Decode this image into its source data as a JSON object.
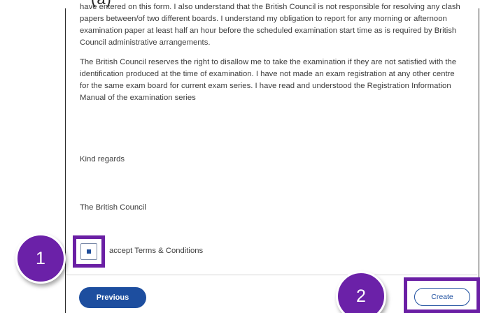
{
  "header": {
    "cut_title": "(a)"
  },
  "terms": {
    "paragraph_1": "have entered on this form. I also understand that the British Council is not responsible for resolving any clash papers between/of two different boards. I understand my obligation to report for any morning or afternoon examination paper at least half an hour before the scheduled examination start time as is required by British Council administrative arrangements.",
    "paragraph_2": "The British Council reserves the right to disallow me to take the examination if they are not satisfied with the identification produced at the time of examination. I have not made an exam registration at any other centre for the same exam board for current exam series. I have read and understood the Registration Information Manual of the examination series",
    "closing": "Kind regards",
    "signature": "The British Council"
  },
  "consent": {
    "checkbox_label": "accept Terms & Conditions",
    "checked": true
  },
  "actions": {
    "previous_label": "Previous",
    "create_label": "Create"
  },
  "annotations": {
    "badge_1": "1",
    "badge_2": "2",
    "highlight_color": "#6a1fa4",
    "badge_color": "#6b21a8"
  },
  "colors": {
    "primary_blue": "#1d4e9f",
    "body_text": "#3d3d3d"
  }
}
